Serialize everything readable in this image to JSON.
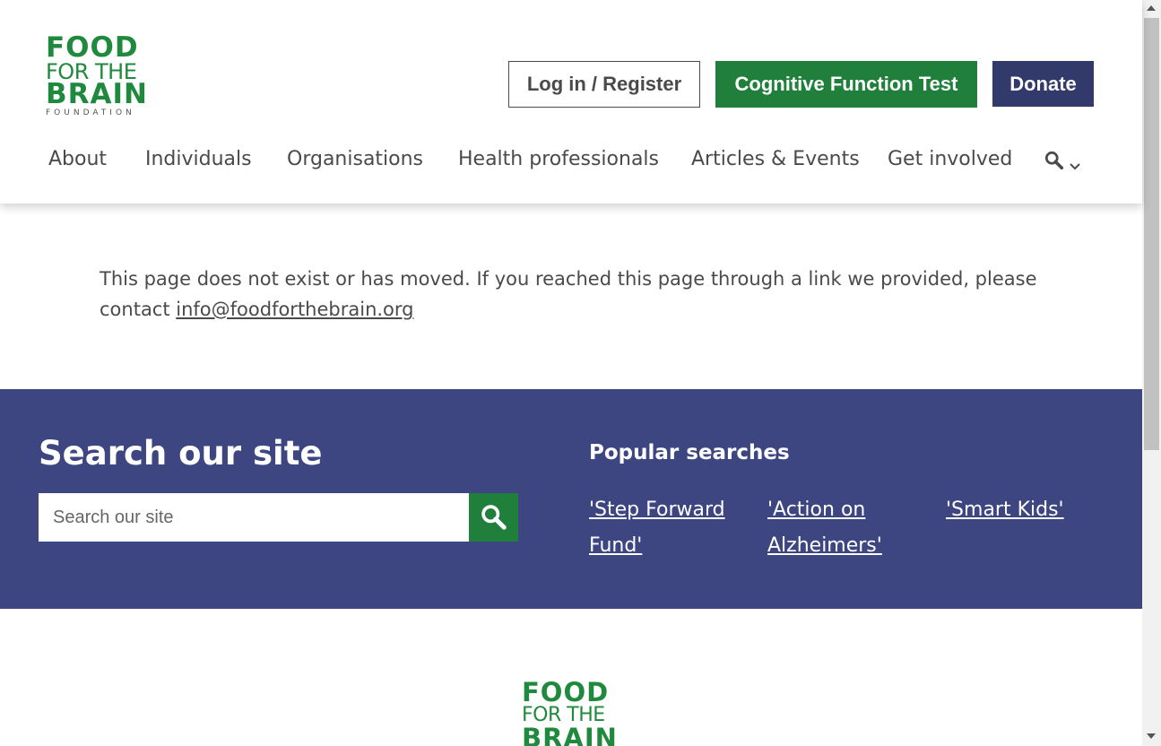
{
  "logo": {
    "line1": "FOOD",
    "line2": "FOR THE",
    "line3": "BRAIN",
    "line4": "FOUNDATION"
  },
  "header": {
    "login_label": "Log in / Register",
    "cft_label": "Cognitive Function Test",
    "donate_label": "Donate"
  },
  "nav": {
    "items": [
      {
        "label": "About"
      },
      {
        "label": "Individuals"
      },
      {
        "label": "Organisations"
      },
      {
        "label": "Health professionals"
      },
      {
        "label": "Articles & Events"
      },
      {
        "label": "Get involved"
      }
    ],
    "search_icon": "search-icon",
    "chevron_icon": "chevron-down-icon"
  },
  "content": {
    "message": "This page does not exist or has moved. If you reached this page through a link we provided, please contact ",
    "email": "info@foodforthebrain.org"
  },
  "search_section": {
    "title": "Search our site",
    "placeholder": "Search our site",
    "popular_title": "Popular searches",
    "popular": [
      {
        "label": "'Step Forward Fund'"
      },
      {
        "label": "'Action on Alzheimers'"
      },
      {
        "label": "'Smart Kids'"
      }
    ]
  },
  "footer_logo": {
    "line1": "FOOD",
    "line2": "FOR THE",
    "line3": "BRAIN"
  },
  "colors": {
    "brand_green": "#1f8a3d",
    "button_green": "#1f7f3b",
    "navy": "#313a6b",
    "band_blue": "#3d4680"
  }
}
